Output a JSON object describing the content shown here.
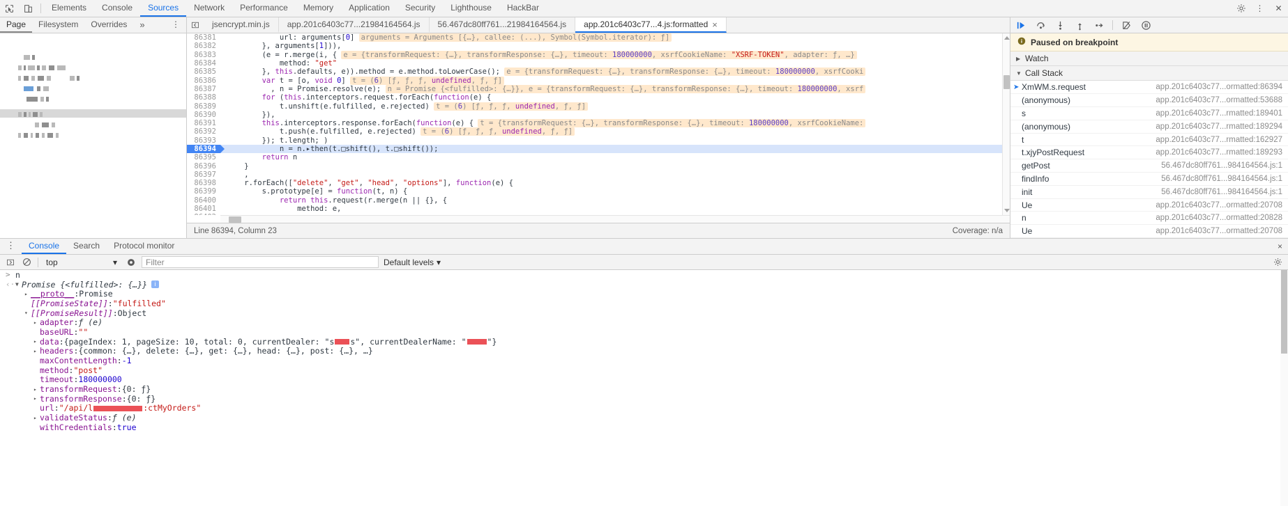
{
  "main_tabs": [
    {
      "label": "Elements",
      "active": false
    },
    {
      "label": "Console",
      "active": false
    },
    {
      "label": "Sources",
      "active": true
    },
    {
      "label": "Network",
      "active": false
    },
    {
      "label": "Performance",
      "active": false
    },
    {
      "label": "Memory",
      "active": false
    },
    {
      "label": "Application",
      "active": false
    },
    {
      "label": "Security",
      "active": false
    },
    {
      "label": "Lighthouse",
      "active": false
    },
    {
      "label": "HackBar",
      "active": false
    }
  ],
  "navigator": {
    "tabs": [
      {
        "label": "Page",
        "active": true
      },
      {
        "label": "Filesystem",
        "active": false
      },
      {
        "label": "Overrides",
        "active": false
      },
      {
        "label": "»",
        "active": false
      }
    ],
    "more_label": "⋮"
  },
  "file_tabs": [
    {
      "label": "jsencrypt.min.js",
      "active": false,
      "closeable": false
    },
    {
      "label": "app.201c6403c77...21984164564.js",
      "active": false,
      "closeable": false
    },
    {
      "label": "56.467dc80ff761...21984164564.js",
      "active": false,
      "closeable": false
    },
    {
      "label": "app.201c6403c77...4.js:formatted",
      "active": true,
      "closeable": true,
      "close": "×"
    }
  ],
  "editor": {
    "status_left": "Line 86394, Column 23",
    "status_right": "Coverage: n/a",
    "lines": [
      {
        "n": "86381",
        "code": "            url: arguments[0]",
        "hint": "arguments = Arguments [{…}, callee: (...), Symbol(Symbol.iterator): ƒ]"
      },
      {
        "n": "86382",
        "code": "        }, arguments[1])),",
        "hint": ""
      },
      {
        "n": "86383",
        "code": "        (e = r.merge(i, {",
        "hint": "e = {transformRequest: {…}, transformResponse: {…}, timeout: 180000000, xsrfCookieName: \"XSRF-TOKEN\", adapter: ƒ, …}"
      },
      {
        "n": "86384",
        "code": "            method: \"get\"",
        "hint": ""
      },
      {
        "n": "86385",
        "code": "        }, this.defaults, e)).method = e.method.toLowerCase();",
        "hint": "e = {transformRequest: {…}, transformResponse: {…}, timeout: 180000000, xsrfCooki"
      },
      {
        "n": "86386",
        "code": "        var t = [o, void 0]",
        "hint": "t = (6) [ƒ, ƒ, ƒ, undefined, ƒ, ƒ]"
      },
      {
        "n": "86387",
        "code": "          , n = Promise.resolve(e);",
        "hint": "n = Promise {<fulfilled>: {…}}, e = {transformRequest: {…}, transformResponse: {…}, timeout: 180000000, xsrf"
      },
      {
        "n": "86388",
        "code": "        for (this.interceptors.request.forEach(function(e) {",
        "hint": ""
      },
      {
        "n": "86389",
        "code": "            t.unshift(e.fulfilled, e.rejected)",
        "hint": "t = (6) [ƒ, ƒ, ƒ, undefined, ƒ, ƒ]"
      },
      {
        "n": "86390",
        "code": "        }),",
        "hint": ""
      },
      {
        "n": "86391",
        "code": "        this.interceptors.response.forEach(function(e) {",
        "hint": "t = {transformRequest: {…}, transformResponse: {…}, timeout: 180000000, xsrfCookieName:"
      },
      {
        "n": "86392",
        "code": "            t.push(e.fulfilled, e.rejected)",
        "hint": "t = (6) [ƒ, ƒ, ƒ, undefined, ƒ, ƒ]"
      },
      {
        "n": "86393",
        "code": "        }); t.length; )",
        "hint": ""
      },
      {
        "n": "86394",
        "code": "            n = n.▸then(t.□shift(), t.□shift());",
        "hint": "",
        "highlight": true
      },
      {
        "n": "86395",
        "code": "        return n",
        "hint": ""
      },
      {
        "n": "86396",
        "code": "    }",
        "hint": ""
      },
      {
        "n": "86397",
        "code": "    ,",
        "hint": ""
      },
      {
        "n": "86398",
        "code": "    r.forEach([\"delete\", \"get\", \"head\", \"options\"], function(e) {",
        "hint": ""
      },
      {
        "n": "86399",
        "code": "        s.prototype[e] = function(t, n) {",
        "hint": ""
      },
      {
        "n": "86400",
        "code": "            return this.request(r.merge(n || {}, {",
        "hint": ""
      },
      {
        "n": "86401",
        "code": "                method: e,",
        "hint": ""
      },
      {
        "n": "86402",
        "code": "",
        "hint": ""
      }
    ]
  },
  "debugger": {
    "paused_text": "Paused on breakpoint",
    "toolbar_buttons": [
      {
        "name": "resume",
        "glyph": "▶"
      },
      {
        "name": "step-over",
        "glyph": "⤷"
      },
      {
        "name": "step-into",
        "glyph": "↓"
      },
      {
        "name": "step-out",
        "glyph": "↑"
      },
      {
        "name": "step",
        "glyph": "→"
      },
      {
        "name": "deactivate-breakpoints",
        "glyph": "⦸"
      },
      {
        "name": "pause-on-exceptions",
        "glyph": "⏸"
      }
    ],
    "watch_label": "Watch",
    "call_stack_label": "Call Stack",
    "call_stack": [
      {
        "name": "XmWM.s.request",
        "location": "app.201c6403c77...ormatted:86394",
        "selected": true
      },
      {
        "name": "(anonymous)",
        "location": "app.201c6403c77...ormatted:53688",
        "selected": false
      },
      {
        "name": "s",
        "location": "app.201c6403c77...rmatted:189401",
        "selected": false
      },
      {
        "name": "(anonymous)",
        "location": "app.201c6403c77...rmatted:189294",
        "selected": false
      },
      {
        "name": "t",
        "location": "app.201c6403c77...rmatted:162927",
        "selected": false
      },
      {
        "name": "t.xjyPostRequest",
        "location": "app.201c6403c77...rmatted:189293",
        "selected": false
      },
      {
        "name": "getPost",
        "location": "56.467dc80ff761...984164564.js:1",
        "selected": false
      },
      {
        "name": "findInfo",
        "location": "56.467dc80ff761...984164564.js:1",
        "selected": false
      },
      {
        "name": "init",
        "location": "56.467dc80ff761...984164564.js:1",
        "selected": false
      },
      {
        "name": "Ue",
        "location": "app.201c6403c77...ormatted:20708",
        "selected": false
      },
      {
        "name": "n",
        "location": "app.201c6403c77...ormatted:20828",
        "selected": false
      },
      {
        "name": "Ue",
        "location": "app.201c6403c77...ormatted:20708",
        "selected": false
      }
    ]
  },
  "drawer": {
    "tabs": [
      {
        "label": "Console",
        "active": true
      },
      {
        "label": "Search",
        "active": false
      },
      {
        "label": "Protocol monitor",
        "active": false
      }
    ],
    "more_label": "⋮",
    "close_label": "×"
  },
  "console_toolbar": {
    "context": "top",
    "context_caret": "▾",
    "filter_placeholder": "Filter",
    "levels_label": "Default levels",
    "levels_caret": "▾",
    "settings_glyph": "⚙"
  },
  "console": {
    "prompt_glyph": ">",
    "return_glyph": "‹·",
    "input_expression": "n",
    "result_header": "Promise {<fulfilled>: {…}}",
    "info_badge": "i",
    "rows": [
      {
        "indent": 1,
        "tri": "▸",
        "key": "__proto__",
        "sep": ": ",
        "value": "Promise",
        "keyclass": "proto-u",
        "valclass": "c-grey"
      },
      {
        "indent": 1,
        "tri": "",
        "key": "[[PromiseState]]",
        "sep": ": ",
        "value": "\"fulfilled\"",
        "keyclass": "c-purple c-ital",
        "valclass": "c-pink"
      },
      {
        "indent": 1,
        "tri": "▾",
        "key": "[[PromiseResult]]",
        "sep": ": ",
        "value": "Object",
        "keyclass": "c-purple c-ital",
        "valclass": "c-grey"
      },
      {
        "indent": 2,
        "tri": "▸",
        "key": "adapter",
        "sep": ": ",
        "value": "ƒ (e)",
        "keyclass": "c-purple",
        "valclass": "c-grey c-ital"
      },
      {
        "indent": 2,
        "tri": "",
        "key": "baseURL",
        "sep": ": ",
        "value": "\"\"",
        "keyclass": "c-purple",
        "valclass": "c-pink"
      },
      {
        "indent": 2,
        "tri": "▸",
        "key": "data",
        "sep": ": ",
        "value": "{pageIndex: 1, pageSize: 10, total: 0, currentDealer: \"s███s\", currentDealerName: \"████\"}",
        "keyclass": "c-purple",
        "valclass": "c-grey",
        "redacted": true
      },
      {
        "indent": 2,
        "tri": "▸",
        "key": "headers",
        "sep": ": ",
        "value": "{common: {…}, delete: {…}, get: {…}, head: {…}, post: {…}, …}",
        "keyclass": "c-purple",
        "valclass": "c-grey"
      },
      {
        "indent": 2,
        "tri": "",
        "key": "maxContentLength",
        "sep": ": ",
        "value": "-1",
        "keyclass": "c-purple",
        "valclass": "c-blue"
      },
      {
        "indent": 2,
        "tri": "",
        "key": "method",
        "sep": ": ",
        "value": "\"post\"",
        "keyclass": "c-purple",
        "valclass": "c-pink"
      },
      {
        "indent": 2,
        "tri": "",
        "key": "timeout",
        "sep": ": ",
        "value": "180000000",
        "keyclass": "c-purple",
        "valclass": "c-blue"
      },
      {
        "indent": 2,
        "tri": "▸",
        "key": "transformRequest",
        "sep": ": ",
        "value": "{0: ƒ}",
        "keyclass": "c-purple",
        "valclass": "c-grey"
      },
      {
        "indent": 2,
        "tri": "▸",
        "key": "transformResponse",
        "sep": ": ",
        "value": "{0: ƒ}",
        "keyclass": "c-purple",
        "valclass": "c-grey"
      },
      {
        "indent": 2,
        "tri": "",
        "key": "url",
        "sep": ": ",
        "value": "\"/api/l██████████:ctMyOrders\"",
        "keyclass": "c-purple",
        "valclass": "c-pink",
        "redacted": true
      },
      {
        "indent": 2,
        "tri": "▸",
        "key": "validateStatus",
        "sep": ": ",
        "value": "ƒ (e)",
        "keyclass": "c-purple",
        "valclass": "c-grey c-ital"
      },
      {
        "indent": 2,
        "tri": "",
        "key": "withCredentials",
        "sep": ": ",
        "value": "true",
        "keyclass": "c-purple",
        "valclass": "c-blue"
      }
    ]
  },
  "colors": {
    "accent": "#1a73e8",
    "breakpoint_line": "#d7e4fb",
    "breakpoint_gutter": "#4285f4",
    "hint_bg": "#ffe8cc",
    "paused_bg": "#fdf6e3",
    "toolbar_bg": "#f3f3f3"
  }
}
